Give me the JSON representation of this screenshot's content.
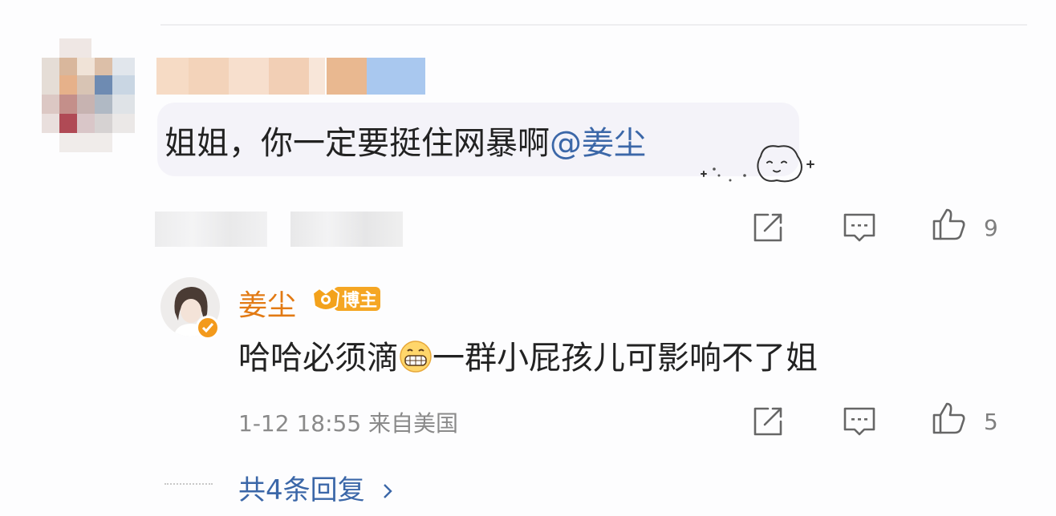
{
  "comment": {
    "text": "姐姐，你一定要挺住网暴啊",
    "mention": "@姜尘",
    "sticker_icon": "cute-cat-sticker-icon",
    "likes": "9"
  },
  "reply": {
    "author": "姜尘",
    "badge_label": "博主",
    "text_before": "哈哈必须滴",
    "emoji_icon": "grinning-face-icon",
    "text_after": "一群小屁孩儿可影响不了姐",
    "timestamp": "1-12 18:55",
    "location": "来自美国",
    "likes": "5"
  },
  "more_replies": "共4条回复",
  "colors": {
    "link_blue": "#3b67a8",
    "name_orange": "#e27a14",
    "badge_orange": "#f39a1c",
    "bubble_bg": "#f4f3f9"
  }
}
